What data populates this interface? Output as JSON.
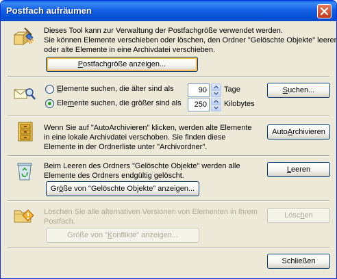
{
  "window": {
    "title": "Postfach aufräumen"
  },
  "section1": {
    "text_line1": "Dieses Tool kann zur Verwaltung der Postfachgröße verwendet werden.",
    "text_line2": "Sie können Elemente verschieben oder löschen, den Ordner \"Gelöschte Objekte\" leeren",
    "text_line3": "oder alte Elemente in eine Archivdatei verschieben.",
    "button_underline": "P",
    "button_rest": "ostfachgröße anzeigen..."
  },
  "section2": {
    "option_older": {
      "underline": "E",
      "rest": "lemente suchen, die älter sind als",
      "value": "90",
      "unit": "Tage",
      "selected": false
    },
    "option_larger": {
      "before": "Ele",
      "underline": "m",
      "rest": "ente suchen, die größer sind als",
      "value": "250",
      "unit": "Kilobytes",
      "selected": true
    },
    "search_button_underline": "S",
    "search_button_rest": "uchen..."
  },
  "section3": {
    "text_line1": "Wenn Sie auf \"AutoArchivieren\" klicken, werden alte Elemente",
    "text_line2": "in eine lokale Archivdatei verschoben. Sie finden diese",
    "text_line3": "Elemente in der Ordnerliste unter \"Archivordner\".",
    "button_before": "Auto",
    "button_underline": "A",
    "button_rest": "rchivieren"
  },
  "section4": {
    "text_line1": "Beim Leeren des Ordners \"Gelöschte Objekte\" werden alle",
    "text_line2": "Elemente des Ordners endgültig gelöscht.",
    "empty_button_underline": "L",
    "empty_button_rest": "eeren",
    "show_button_before": "Gr",
    "show_button_underline": "ö",
    "show_button_rest": "ße von \"Gelöschte Objekte\" anzeigen..."
  },
  "section5": {
    "text_line1": "Löschen Sie alle alternativen Versionen von Elementen in Ihrem",
    "text_line2": "Postfach.",
    "delete_button_before": "Lösc",
    "delete_button_underline": "h",
    "delete_button_rest": "en",
    "show_button_before": "Größe von \"",
    "show_button_underline": "K",
    "show_button_rest": "onflikte\" anzeigen..."
  },
  "footer": {
    "close_label": "Schließen"
  },
  "colors": {
    "titlebar": "#0a5fe8",
    "dialog_bg": "#ece9d8",
    "disabled_text": "#aca899",
    "radio_dot": "#21a121"
  },
  "icons": [
    "mailbox-cleanup-icon",
    "search-mailbox-icon",
    "archive-icon",
    "recycle-bin-icon",
    "conflicts-folder-icon",
    "close-icon",
    "spin-up-icon",
    "spin-down-icon"
  ]
}
